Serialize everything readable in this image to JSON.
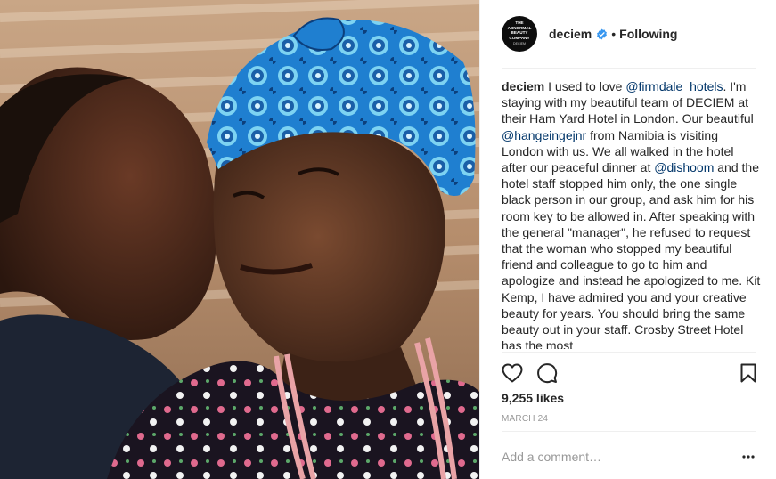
{
  "profile": {
    "avatar_line1": "THE",
    "avatar_line2": "ABNORMAL",
    "avatar_line3": "BEAUTY",
    "avatar_line4": "COMPANY",
    "avatar_line5": "DECIEM",
    "username": "deciem",
    "separator": "•",
    "follow_label": "Following"
  },
  "caption": {
    "author": "deciem",
    "t1": "I used to love",
    "m1": "@firmdale_hotels",
    "t2": ". I'm staying with my beautiful team of DECIEM at their Ham Yard Hotel in London. Our beautiful",
    "m2": "@hangeingejnr",
    "t3": "from Namibia is visiting London with us. We all walked in the hotel after our peaceful dinner at",
    "m3": "@dishoom",
    "t4": "and the hotel staff stopped him only, the one single black person in our group, and ask him for his room key to be allowed in. After speaking with the general \"manager\", he refused to request that the woman who stopped my beautiful friend and colleague to go to him and apologize and instead he apologized to me. Kit Kemp, I have admired you and your creative beauty for years. You should bring the same beauty out in your staff. Crosby Street Hotel has the most"
  },
  "stats": {
    "likes": "9,255 likes",
    "date": "MARCH 24"
  },
  "comment": {
    "placeholder": "Add a comment…"
  },
  "colors": {
    "mention": "#003569",
    "verified": "#3897f0",
    "muted": "#999999",
    "divider": "#efefef"
  },
  "icons": [
    "heart-icon",
    "comment-icon",
    "bookmark-icon",
    "more-options-icon",
    "verified-badge-icon"
  ]
}
